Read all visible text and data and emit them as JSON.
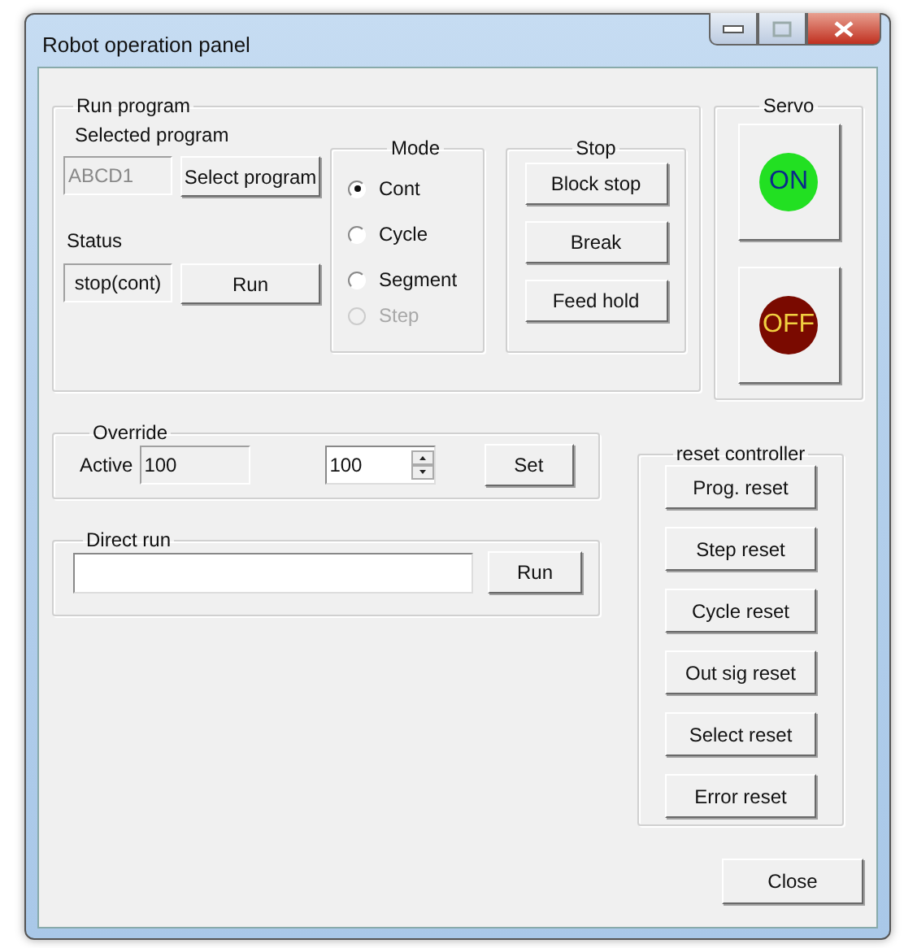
{
  "window": {
    "title": "Robot operation panel"
  },
  "run_program": {
    "label": "Run program",
    "selected_program_label": "Selected program",
    "selected_program": "ABCD1",
    "select_button": "Select program",
    "status_label": "Status",
    "status": "stop(cont)",
    "run_button": "Run"
  },
  "mode": {
    "label": "Mode",
    "options": [
      {
        "label": "Cont",
        "selected": true,
        "disabled": false
      },
      {
        "label": "Cycle",
        "selected": false,
        "disabled": false
      },
      {
        "label": "Segment",
        "selected": false,
        "disabled": false
      },
      {
        "label": "Step",
        "selected": false,
        "disabled": true
      }
    ]
  },
  "stop": {
    "label": "Stop",
    "buttons": [
      "Block stop",
      "Break",
      "Feed hold"
    ]
  },
  "servo": {
    "label": "Servo",
    "buttons": [
      {
        "label": "ON",
        "kind": "on",
        "color": "#22e022"
      },
      {
        "label": "OFF",
        "kind": "off",
        "color": "#7a0a00"
      }
    ]
  },
  "override": {
    "label": "Override",
    "active_label": "Active",
    "active_value": "100",
    "spin_value": "100",
    "set_button": "Set"
  },
  "direct_run": {
    "label": "Direct run",
    "run_button": "Run"
  },
  "reset_controller": {
    "label": "reset controller",
    "buttons": [
      "Prog. reset",
      "Step reset",
      "Cycle reset",
      "Out sig reset",
      "Select reset",
      "Error reset"
    ]
  },
  "close_button": "Close"
}
